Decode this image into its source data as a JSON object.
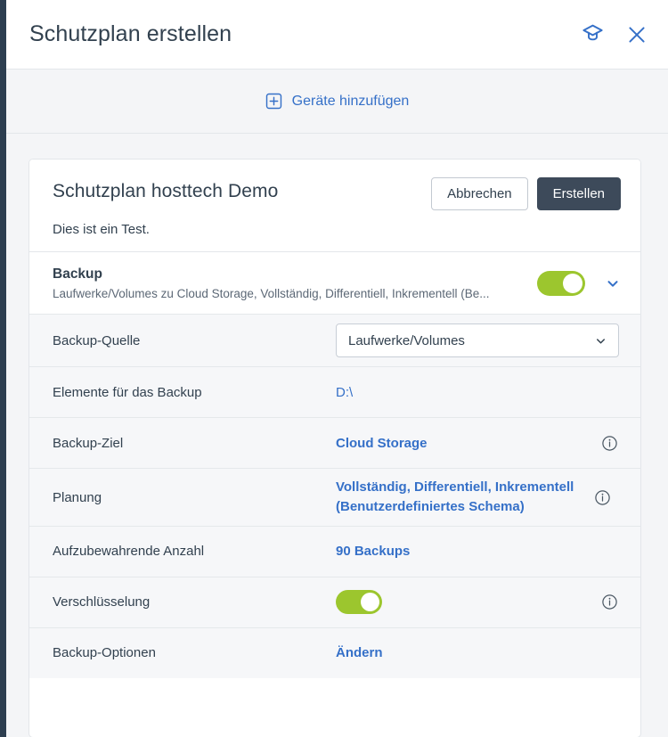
{
  "window": {
    "title": "Schutzplan erstellen",
    "academy_icon": "graduation-cap-icon",
    "close_icon": "close-icon"
  },
  "device_bar": {
    "add_devices_label": "Geräte hinzufügen",
    "add_icon": "plus-square-icon"
  },
  "plan": {
    "name": "Schutzplan hosttech Demo",
    "description": "Dies ist ein Test.",
    "cancel_label": "Abbrechen",
    "create_label": "Erstellen"
  },
  "module": {
    "title": "Backup",
    "subtitle": "Laufwerke/Volumes zu Cloud Storage, Vollständig, Differentiell, Inkrementell (Be...",
    "toggle_on": true,
    "collapse_icon": "chevron-down-icon"
  },
  "rows": [
    {
      "label": "Backup-Quelle",
      "kind": "select",
      "value": "Laufwerke/Volumes",
      "info": false
    },
    {
      "label": "Elemente für das Backup",
      "kind": "link",
      "value": "D:\\",
      "info": false
    },
    {
      "label": "Backup-Ziel",
      "kind": "link-strong",
      "value": "Cloud Storage",
      "info": true
    },
    {
      "label": "Planung",
      "kind": "link-multiline",
      "value": "Vollständig, Differentiell, Inkrementell (Benutzerdefiniertes Schema)",
      "info": true
    },
    {
      "label": "Aufzubewahrende Anzahl",
      "kind": "link-strong",
      "value": "90 Backups",
      "info": false
    },
    {
      "label": "Verschlüsselung",
      "kind": "toggle",
      "value": "",
      "toggle_on": true,
      "info": true
    },
    {
      "label": "Backup-Optionen",
      "kind": "link-strong",
      "value": "Ändern",
      "info": false
    }
  ],
  "colors": {
    "accent_link": "#3570c8",
    "toggle_on": "#9cc62e",
    "primary_button": "#3d4a5a",
    "rail": "#2d3e50",
    "page_bg": "#f4f5f7",
    "row_bg": "#f6f7f9"
  }
}
